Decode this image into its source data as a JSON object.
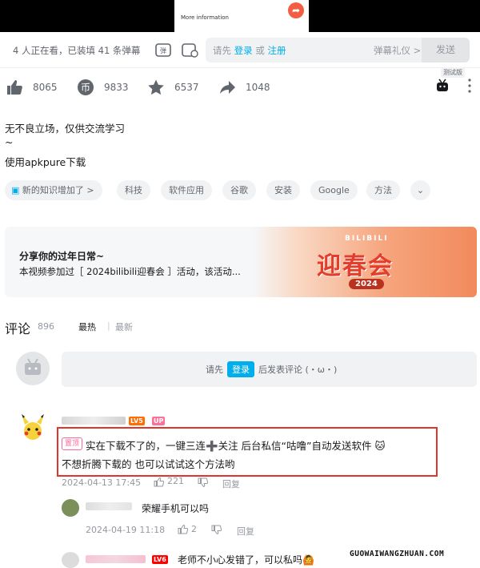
{
  "video": {
    "partial_text": "More information"
  },
  "danmaku": {
    "viewer_status": "4 人正在看，已装填 41 条弹幕",
    "prompt_prefix": "请先",
    "login_link": "登录",
    "or_text": "或",
    "register_link": "注册",
    "etiquette": "弹幕礼仪 >",
    "send": "发送"
  },
  "actions": {
    "like": "8065",
    "coin": "9833",
    "favorite": "6537",
    "share": "1048",
    "trial_label": "测试版"
  },
  "description": {
    "line1": "无不良立场，仅供交流学习",
    "line2": "~",
    "line3": "使用apkpure下载"
  },
  "tags": [
    "新的知识增加了 >",
    "科技",
    "软件应用",
    "谷歌",
    "安装",
    "Google",
    "方法"
  ],
  "banner": {
    "title": "分享你的过年日常~",
    "subtitle": "本视频参加过［ 2024bilibili迎春会 ］活动，该活动...",
    "art_brand": "BILIBILI",
    "art_title": "迎春会",
    "art_year": "2024"
  },
  "comments": {
    "title": "评论",
    "count": "896",
    "sort_hot": "最热",
    "sort_sep": "|",
    "sort_new": "最新",
    "login_prefix": "请先",
    "login_button": "登录",
    "login_suffix": "后发表评论 (・ω・)",
    "items": [
      {
        "level": "LV5",
        "up_badge": "UP",
        "pinned": "置顶",
        "line1": "实在下载不了的，一键三连➕关注 后台私信“咕噜”自动发送软件 🐱",
        "line2": "不想折腾下载的 也可以试试这个方法哟",
        "time": "2024-04-13 17:45",
        "likes": "221",
        "reply": "回复"
      }
    ],
    "replies": [
      {
        "text": "荣耀手机可以吗",
        "time": "2024-04-19 11:18",
        "likes": "2",
        "reply": "回复"
      },
      {
        "level": "LV6",
        "text": "老师不小心发错了，可以私吗🙆"
      }
    ]
  },
  "watermark": "GUOWAIWANGZHUAN.COM"
}
